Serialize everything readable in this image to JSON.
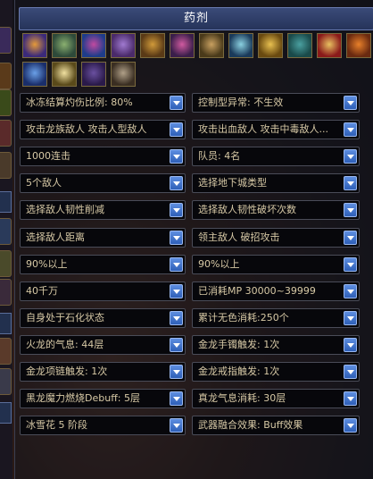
{
  "panel": {
    "title": "药剂"
  },
  "icons": [
    {
      "name": "ice-crystal-icon",
      "c1": "#3b2a7a",
      "c2": "#e49a3a"
    },
    {
      "name": "potion-jar-icon",
      "c1": "#2e4a3a",
      "c2": "#8ab070"
    },
    {
      "name": "blue-scroll-icon",
      "c1": "#1e3c8a",
      "c2": "#c04aa0"
    },
    {
      "name": "purple-flask-icon",
      "c1": "#4a2a6a",
      "c2": "#a07ad0"
    },
    {
      "name": "gold-crest-icon",
      "c1": "#5a3a16",
      "c2": "#d09a3a"
    },
    {
      "name": "pink-vial-icon",
      "c1": "#3a1e4a",
      "c2": "#d05aa0"
    },
    {
      "name": "bottle-icon",
      "c1": "#4a3a1a",
      "c2": "#c8a060"
    },
    {
      "name": "sword-icon",
      "c1": "#1a3a5a",
      "c2": "#8ad0e0"
    },
    {
      "name": "gold-bar-icon",
      "c1": "#6a4a10",
      "c2": "#e8c050"
    },
    {
      "name": "dragon-icon",
      "c1": "#1a4a4a",
      "c2": "#4aa0a0"
    },
    {
      "name": "gift-box-icon",
      "c1": "#8a1a1a",
      "c2": "#e8c060"
    },
    {
      "name": "fire-orb-icon",
      "c1": "#6a2a10",
      "c2": "#e8802a"
    },
    {
      "name": "lightning-icon",
      "c1": "#1a2e6a",
      "c2": "#6aa0e8"
    },
    {
      "name": "starburst-icon",
      "c1": "#5a4a1a",
      "c2": "#f0e0a0"
    },
    {
      "name": "gem-icon",
      "c1": "#2a1a4a",
      "c2": "#6a50a0"
    },
    {
      "name": "knot-icon",
      "c1": "#3a2e22",
      "c2": "#b0a088"
    }
  ],
  "dropdowns": [
    [
      "冰冻结算灼伤比例: 80%",
      "控制型异常: 不生效"
    ],
    [
      "攻击龙族敌人 攻击人型敌人",
      "攻击出血敌人 攻击中毒敌人..."
    ],
    [
      "1000连击",
      "队员: 4名"
    ],
    [
      "5个敌人",
      "选择地下城类型"
    ],
    [
      "选择敌人韧性削减",
      "选择敌人韧性破坏次数"
    ],
    [
      "选择敌人距离",
      "领主敌人 破招攻击"
    ],
    [
      "90%以上",
      "90%以上"
    ],
    [
      "40千万",
      "已消耗MP 30000~39999"
    ],
    [
      "自身处于石化状态",
      "累计无色消耗:250个"
    ],
    [
      "火龙的气息: 44层",
      "金龙手镯触发: 1次"
    ],
    [
      "金龙项链触发: 1次",
      "金龙戒指触发: 1次"
    ],
    [
      "黑龙魔力燃烧Debuff: 5层",
      "真龙气息消耗: 30层"
    ],
    [
      "冰雪花 5 阶段",
      "武器融合效果: Buff效果"
    ]
  ]
}
